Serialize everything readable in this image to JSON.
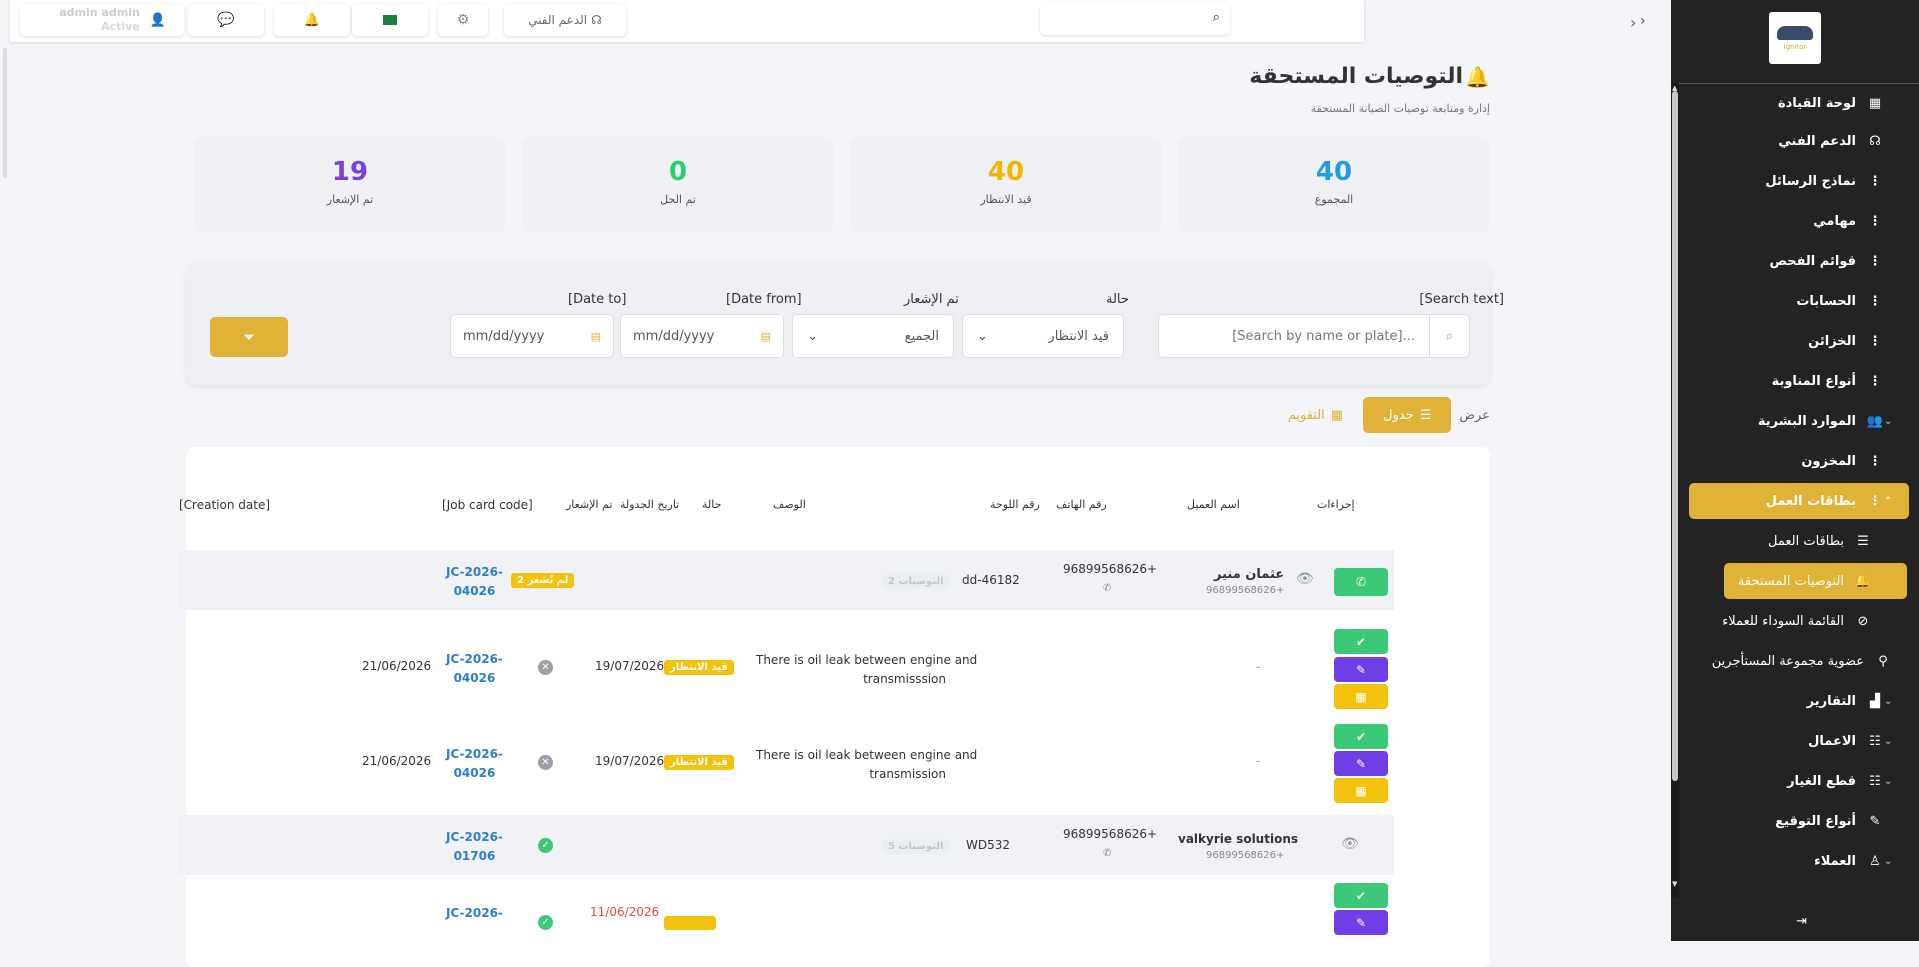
{
  "topbar": {
    "user_name": "admin admin",
    "user_status": "Active",
    "support_label": "الدعم الفني"
  },
  "sidebar": {
    "logo_text": "ignitor",
    "items": [
      {
        "label": "لوحة القيادة",
        "icon": "dashboard-icon"
      },
      {
        "label": "الدعم الفني",
        "icon": "headset-icon"
      },
      {
        "label": "نماذج الرسائل",
        "icon": "kebab-icon"
      },
      {
        "label": "مهامي",
        "icon": "kebab-icon"
      },
      {
        "label": "قوائم الفحص",
        "icon": "kebab-icon"
      },
      {
        "label": "الحسابات",
        "icon": "kebab-icon"
      },
      {
        "label": "الخزائن",
        "icon": "kebab-icon"
      },
      {
        "label": "أنواع المناوبة",
        "icon": "kebab-icon"
      },
      {
        "label": "الموارد البشرية",
        "icon": "users-icon"
      },
      {
        "label": "المخزون",
        "icon": "kebab-icon"
      },
      {
        "label": "بطاقات العمل",
        "icon": "kebab-icon"
      },
      {
        "label": "بطاقات العمل",
        "icon": "list-icon"
      },
      {
        "label": "التوصيات المستحقة",
        "icon": "bell-icon"
      },
      {
        "label": "القائمة السوداء للعملاء",
        "icon": "ban-icon"
      },
      {
        "label": "عضوية مجموعة المستأجرين",
        "icon": "network-icon"
      },
      {
        "label": "التقارير",
        "icon": "chart-icon"
      },
      {
        "label": "الاعمال",
        "icon": "sliders-icon"
      },
      {
        "label": "قطع الغيار",
        "icon": "sliders-icon"
      },
      {
        "label": "أنواع التوقيع",
        "icon": "pen-icon"
      },
      {
        "label": "العملاء",
        "icon": "user-tie-icon"
      }
    ]
  },
  "page": {
    "title": "التوصيات المستحقة",
    "subtitle": "إدارة ومتابعة توصيات الصيانة المستحقة"
  },
  "stats": [
    {
      "value": "40",
      "label": "المجموع",
      "color": "#1e9be9"
    },
    {
      "value": "40",
      "label": "قيد الانتظار",
      "color": "#f4b400"
    },
    {
      "value": "0",
      "label": "تم الحل",
      "color": "#2ecc71"
    },
    {
      "value": "19",
      "label": "تم الإشعار",
      "color": "#7b3fe4"
    }
  ],
  "filters": {
    "search_label": "[Search text]",
    "search_placeholder": "[Search by name or plate]...",
    "status_label": "حالة",
    "status_value": "قيد الانتظار",
    "notified_label": "تم الإشعار",
    "notified_value": "الجميع",
    "date_from_label": "[Date from]",
    "date_from_value": "mm/dd/yyyy",
    "date_to_label": "[Date to]",
    "date_to_value": "mm/dd/yyyy"
  },
  "view": {
    "label": "عرض",
    "table_label": "جدول",
    "calendar_label": "التقويم"
  },
  "table": {
    "headers": {
      "actions": "إجراءات",
      "customer": "اسم العميل",
      "phone": "رقم الهاتف",
      "plate": "رقم اللوحة",
      "description": "الوصف",
      "status": "حالة",
      "schedule_date": "تاريخ الجدولة",
      "notified": "تم الإشعار",
      "job_card": "[Job card code]",
      "creation_date": "[Creation date]"
    },
    "rows": {
      "g1": {
        "customer": "عثمان منير",
        "customer_phone": "96899568626+",
        "phone": "96899568626+",
        "plate": "dd-46182",
        "count_badge": "2 التوصيات",
        "notify_badge": "2 لم تُشعر",
        "job_card_a": "JC-2026-",
        "job_card_b": "04026"
      },
      "r1": {
        "customer_dash": "-",
        "description_a": "There is oil leak between engine and",
        "description_b": "transmisssion",
        "status": "قيد الانتظار",
        "schedule_date": "19/07/2026",
        "job_card_a": "JC-2026-",
        "job_card_b": "04026",
        "creation_date": "21/06/2026"
      },
      "r2": {
        "customer_dash": "-",
        "description_a": "There is oil leak between engine and",
        "description_b": "transmission",
        "status": "قيد الانتظار",
        "schedule_date": "19/07/2026",
        "job_card_a": "JC-2026-",
        "job_card_b": "04026",
        "creation_date": "21/06/2026"
      },
      "g2": {
        "customer": "valkyrie solutions",
        "customer_phone": "96899568626+",
        "phone": "96899568626+",
        "plate": "WD532",
        "count_badge": "5 التوصيات",
        "job_card_a": "JC-2026-",
        "job_card_b": "01706"
      },
      "r3": {
        "schedule_date": "11/06/2026",
        "job_card_a": "JC-2026-"
      }
    }
  }
}
